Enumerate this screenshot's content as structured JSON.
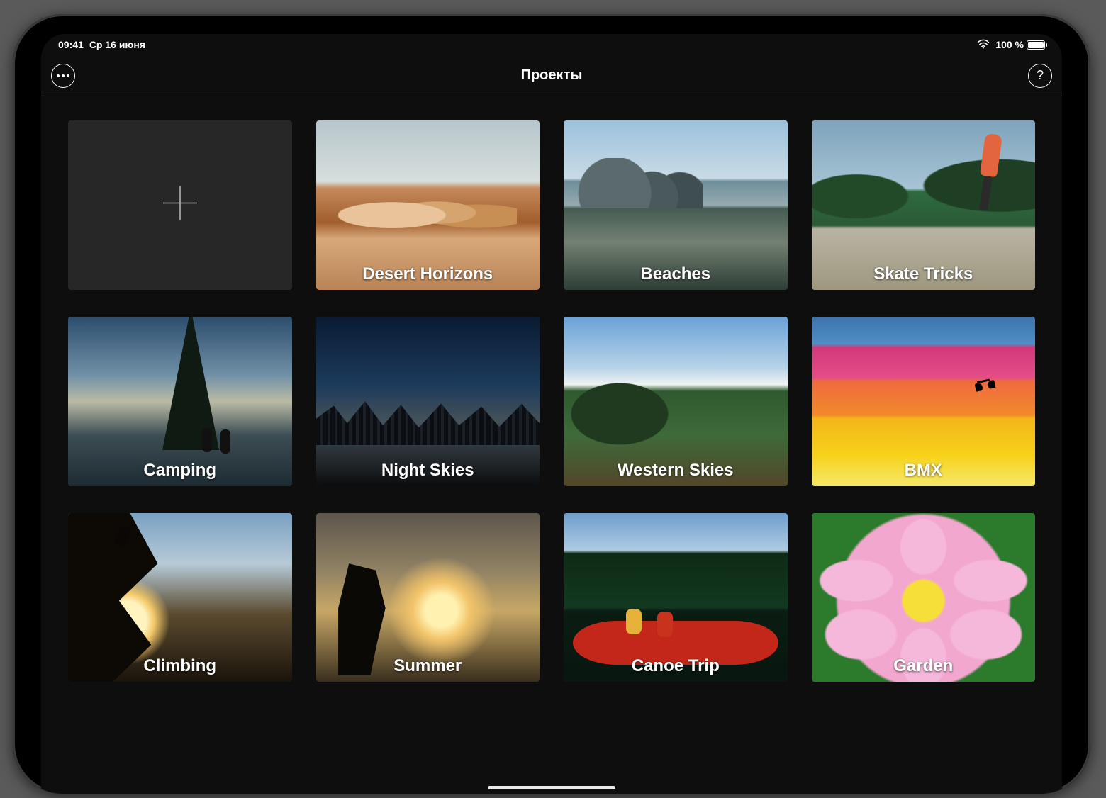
{
  "statusbar": {
    "time": "09:41",
    "date": "Ср 16 июня",
    "battery_pct": "100 %"
  },
  "navbar": {
    "title": "Проекты"
  },
  "projects": [
    {
      "title": "Desert Horizons",
      "art": "art-desert"
    },
    {
      "title": "Beaches",
      "art": "art-beach"
    },
    {
      "title": "Skate Tricks",
      "art": "art-skate"
    },
    {
      "title": "Camping",
      "art": "art-camping"
    },
    {
      "title": "Night Skies",
      "art": "art-night"
    },
    {
      "title": "Western Skies",
      "art": "art-western"
    },
    {
      "title": "BMX",
      "art": "art-bmx"
    },
    {
      "title": "Climbing",
      "art": "art-climb"
    },
    {
      "title": "Summer",
      "art": "art-summer"
    },
    {
      "title": "Canoe Trip",
      "art": "art-canoe"
    },
    {
      "title": "Garden",
      "art": "art-garden"
    }
  ]
}
